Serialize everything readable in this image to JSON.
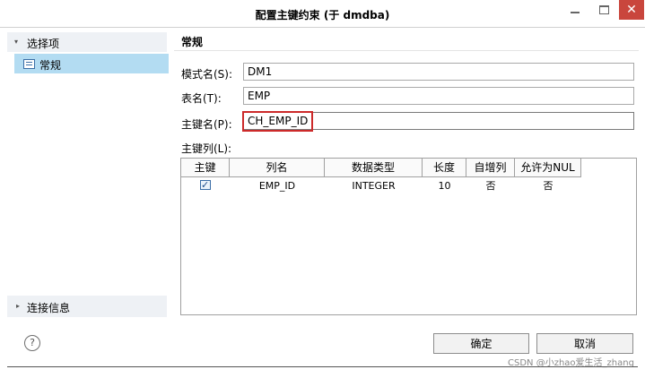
{
  "window": {
    "title": "配置主键约束 (于 dmdba)",
    "close_glyph": "✕"
  },
  "sidebar": {
    "header": {
      "arrow": "▾",
      "label": "选择项"
    },
    "items": [
      {
        "label": "常规",
        "selected": true
      }
    ],
    "footer": {
      "arrow": "▸",
      "label": "连接信息"
    }
  },
  "main": {
    "section_title": "常规",
    "fields": [
      {
        "label": "模式名(S):",
        "value": "DM1"
      },
      {
        "label": "表名(T):",
        "value": "EMP"
      },
      {
        "label": "主键名(P):",
        "value": "CH_EMP_ID"
      }
    ],
    "key_columns_label": "主键列(L):",
    "table": {
      "headers": [
        "主键",
        "列名",
        "数据类型",
        "长度",
        "自增列",
        "允许为NUL"
      ],
      "rows": [
        {
          "primary_key": true,
          "column_name": "EMP_ID",
          "data_type": "INTEGER",
          "length": "10",
          "auto_increment": "否",
          "nullable": "否"
        }
      ]
    }
  },
  "footer": {
    "help_glyph": "?",
    "ok_label": "确定",
    "cancel_label": "取消",
    "watermark": "CSDN @小zhao爱生活_zhang"
  },
  "colors": {
    "selection": "#b3dcf2",
    "close_button": "#c9463d",
    "highlight_border": "#cc2a2a"
  }
}
